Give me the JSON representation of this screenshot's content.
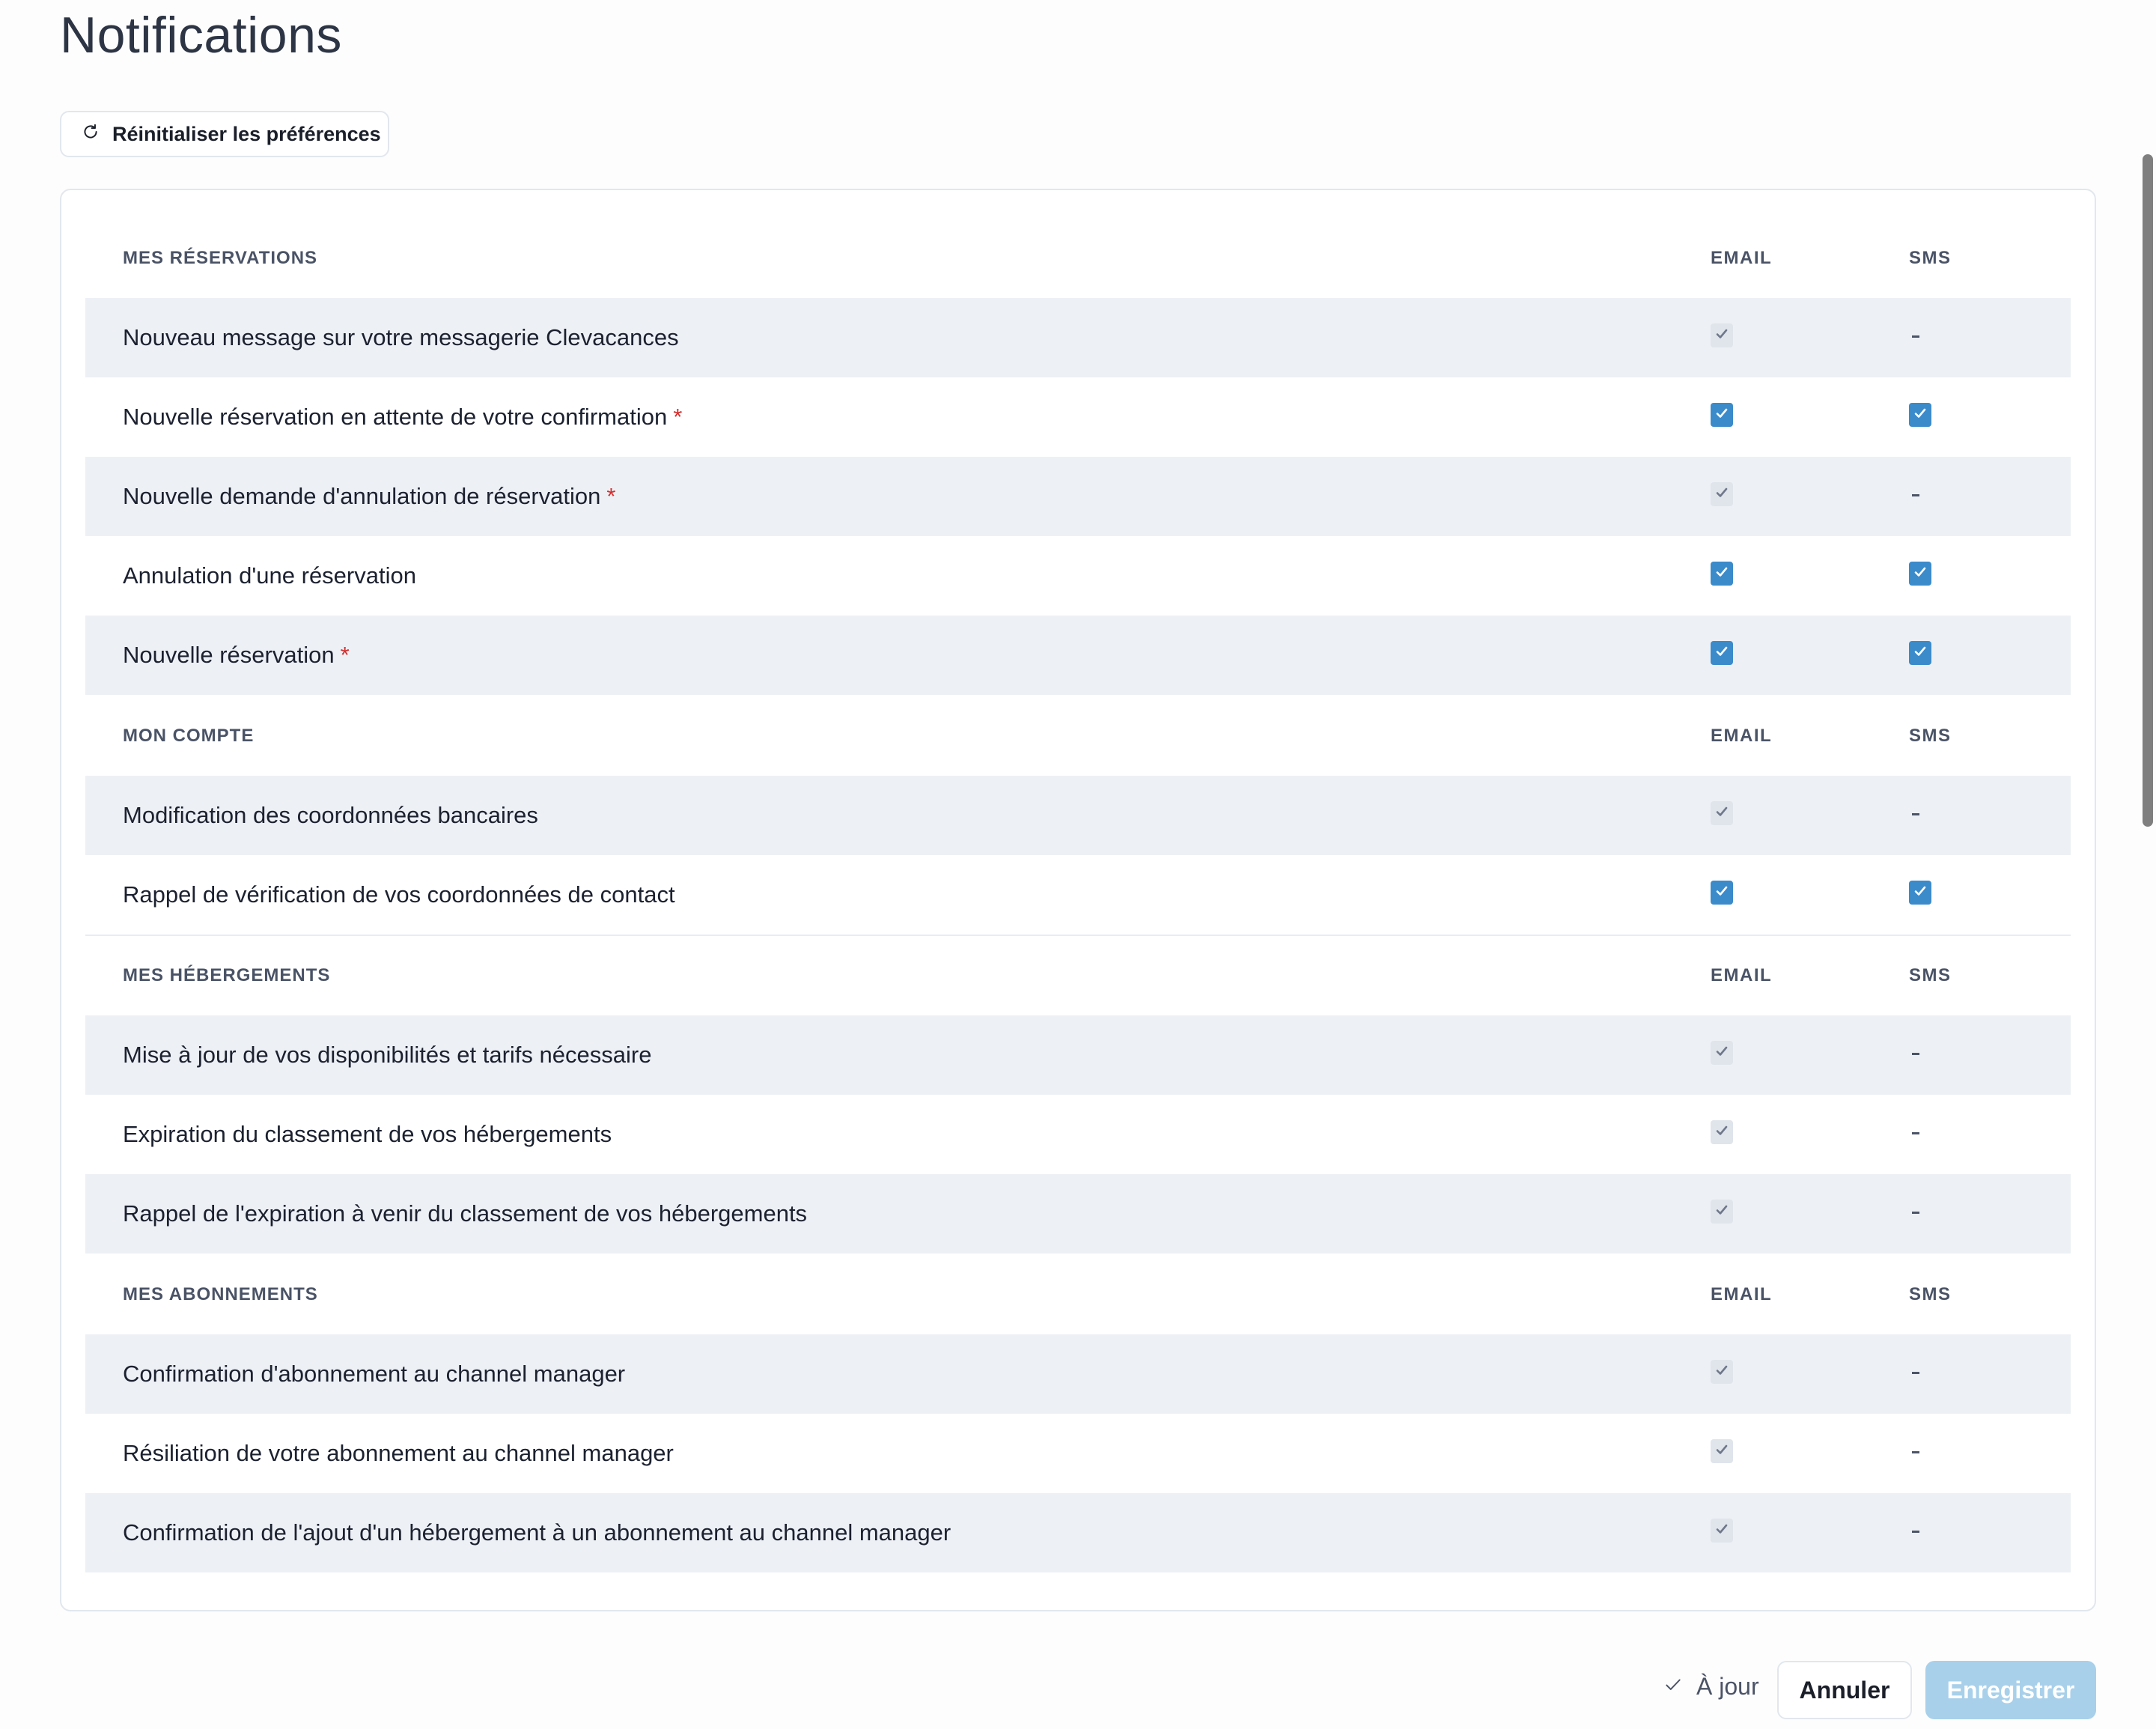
{
  "page": {
    "title": "Notifications",
    "reset_label": "Réinitialiser les préférences"
  },
  "columns": {
    "email": "EMAIL",
    "sms": "SMS"
  },
  "colors": {
    "accent": "#3b8bcb",
    "row_alt": "#edf0f5",
    "required": "#d2302f",
    "save_disabled": "#a8d0ea"
  },
  "sections": [
    {
      "title": "MES RÉSERVATIONS",
      "rows": [
        {
          "label": "Nouveau message sur votre messagerie Clevacances",
          "required": false,
          "email": "locked-checked",
          "sms": "none"
        },
        {
          "label": "Nouvelle réservation en attente de votre confirmation",
          "required": true,
          "email": "checked",
          "sms": "checked"
        },
        {
          "label": "Nouvelle demande d'annulation de réservation",
          "required": true,
          "email": "locked-checked",
          "sms": "none"
        },
        {
          "label": "Annulation d'une réservation",
          "required": false,
          "email": "checked",
          "sms": "checked"
        },
        {
          "label": "Nouvelle réservation",
          "required": true,
          "email": "checked",
          "sms": "checked"
        }
      ]
    },
    {
      "title": "MON COMPTE",
      "rows": [
        {
          "label": "Modification des coordonnées bancaires",
          "required": false,
          "email": "locked-checked",
          "sms": "none"
        },
        {
          "label": "Rappel de vérification de vos coordonnées de contact",
          "required": false,
          "email": "checked",
          "sms": "checked"
        }
      ]
    },
    {
      "title": "MES HÉBERGEMENTS",
      "rows": [
        {
          "label": "Mise à jour de vos disponibilités et tarifs nécessaire",
          "required": false,
          "email": "locked-checked",
          "sms": "none"
        },
        {
          "label": "Expiration du classement de vos hébergements",
          "required": false,
          "email": "locked-checked",
          "sms": "none"
        },
        {
          "label": "Rappel de l'expiration à venir du classement de vos hébergements",
          "required": false,
          "email": "locked-checked",
          "sms": "none"
        }
      ]
    },
    {
      "title": "MES ABONNEMENTS",
      "rows": [
        {
          "label": "Confirmation d'abonnement au channel manager",
          "required": false,
          "email": "locked-checked",
          "sms": "none"
        },
        {
          "label": "Résiliation de votre abonnement au channel manager",
          "required": false,
          "email": "locked-checked",
          "sms": "none"
        },
        {
          "label": "Confirmation de l'ajout d'un hébergement à un abonnement au channel manager",
          "required": false,
          "email": "locked-checked",
          "sms": "none"
        }
      ]
    }
  ],
  "required_mark": "*",
  "none_mark": "–",
  "footer": {
    "status": "À jour",
    "cancel_label": "Annuler",
    "save_label": "Enregistrer"
  }
}
